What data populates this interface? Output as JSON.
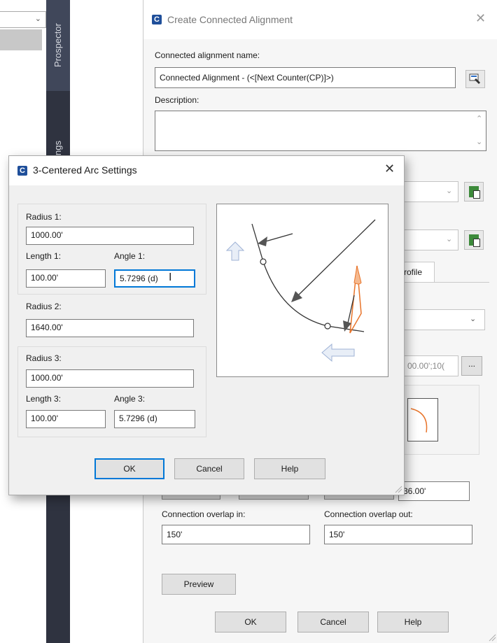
{
  "background": {
    "rail_labels": [
      "Prospector",
      "ngs"
    ]
  },
  "connected_dialog": {
    "title": "Create Connected Alignment",
    "name_label": "Connected alignment name:",
    "name_value": "Connected Alignment - (<[Next Counter(CP)]>)",
    "description_label": "Description:",
    "description_value": "",
    "tab_partial": "rofile",
    "station_partial": "00.00';10(",
    "right_value": "36.00'",
    "overlap_in_label": "Connection overlap in:",
    "overlap_in_value": "150'",
    "overlap_out_label": "Connection overlap out:",
    "overlap_out_value": "150'",
    "preview_label": "Preview",
    "ellipsis_label": "...",
    "ok_label": "OK",
    "cancel_label": "Cancel",
    "help_label": "Help"
  },
  "arc_dialog": {
    "title": "3-Centered Arc Settings",
    "radius1_label": "Radius 1:",
    "radius1_value": "1000.00'",
    "length1_label": "Length 1:",
    "length1_value": "100.00'",
    "angle1_label": "Angle 1:",
    "angle1_value": "5.7296 (d)",
    "radius2_label": "Radius 2:",
    "radius2_value": "1640.00'",
    "radius3_label": "Radius 3:",
    "radius3_value": "1000.00'",
    "length3_label": "Length 3:",
    "length3_value": "100.00'",
    "angle3_label": "Angle 3:",
    "angle3_value": "5.7296 (d)",
    "ok_label": "OK",
    "cancel_label": "Cancel",
    "help_label": "Help"
  },
  "colors": {
    "accent": "#0078d7",
    "rail": "#2f3340",
    "diagram_orange": "#e8742a"
  }
}
